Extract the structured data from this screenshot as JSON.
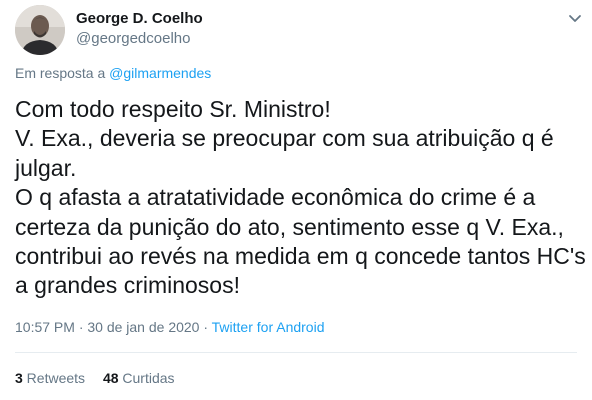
{
  "author": {
    "display_name": "George D. Coelho",
    "handle": "@georgedcoelho"
  },
  "reply": {
    "prefix": "Em resposta a ",
    "mention": "@gilmarmendes"
  },
  "tweet": {
    "lines": [
      "Com todo respeito Sr. Ministro!",
      "V. Exa., deveria se preocupar com sua atribuição q é",
      "julgar.",
      "O q afasta a atratatividade econômica do crime é a",
      "certeza da punição do ato, sentimento esse q V. Exa.,",
      "contribui ao revés na medida em q concede tantos HC's",
      "a grandes criminosos!"
    ]
  },
  "meta": {
    "timestamp": "10:57 PM · 30 de jan de 2020 · ",
    "source": "Twitter for Android"
  },
  "stats": {
    "retweets_count": "3",
    "retweets_label": " Retweets",
    "likes_count": "48",
    "likes_label": " Curtidas"
  },
  "icons": {
    "menu": "chevron-down-icon"
  },
  "colors": {
    "link": "#1da1f2",
    "secondary_text": "#657786",
    "primary_text": "#14171a",
    "divider": "#e6ecf0"
  }
}
